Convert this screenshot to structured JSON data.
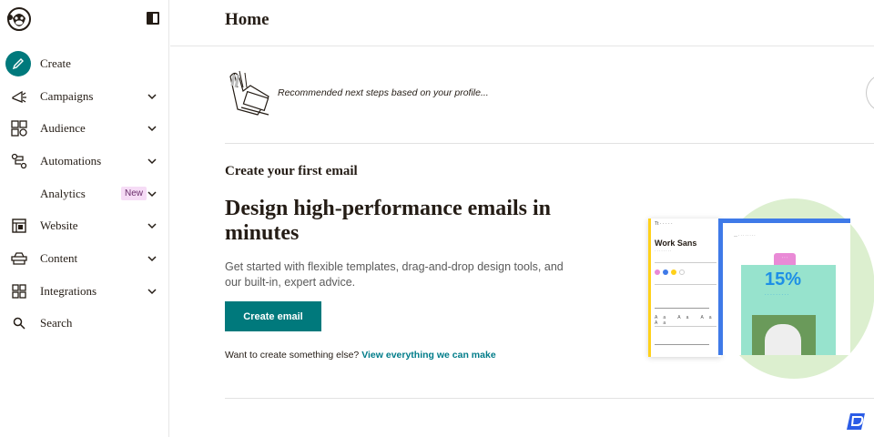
{
  "sidebar": {
    "logo_icon": "freddie-chimp-logo",
    "collapse_icon": "sidebar-toggle-icon",
    "items": [
      {
        "label": "Create",
        "icon": "pencil-icon",
        "chevron": false,
        "badge": ""
      },
      {
        "label": "Campaigns",
        "icon": "megaphone-icon",
        "chevron": true,
        "badge": ""
      },
      {
        "label": "Audience",
        "icon": "audience-icon",
        "chevron": true,
        "badge": ""
      },
      {
        "label": "Automations",
        "icon": "automations-icon",
        "chevron": true,
        "badge": ""
      },
      {
        "label": "Analytics",
        "icon": "",
        "chevron": true,
        "badge": "New"
      },
      {
        "label": "Website",
        "icon": "website-icon",
        "chevron": true,
        "badge": ""
      },
      {
        "label": "Content",
        "icon": "content-icon",
        "chevron": true,
        "badge": ""
      },
      {
        "label": "Integrations",
        "icon": "integrations-icon",
        "chevron": true,
        "badge": ""
      },
      {
        "label": "Search",
        "icon": "search-icon",
        "chevron": false,
        "badge": ""
      }
    ]
  },
  "header": {
    "title": "Home"
  },
  "recommendations": {
    "text": "Recommended next steps based on your profile..."
  },
  "create_email": {
    "section_title": "Create your first email",
    "heading": "Design high-performance emails in minutes",
    "description": "Get started with flexible templates, drag-and-drop design tools, and our built-in, expert advice.",
    "button_label": "Create email",
    "more_prompt": "Want to create something else?",
    "more_link": "View everything we can make"
  },
  "illustration": {
    "font_name": "Work Sans",
    "discount": "15%"
  },
  "colors": {
    "accent": "#00797c",
    "link": "#007c89",
    "badge_bg": "#f6dcf6"
  }
}
